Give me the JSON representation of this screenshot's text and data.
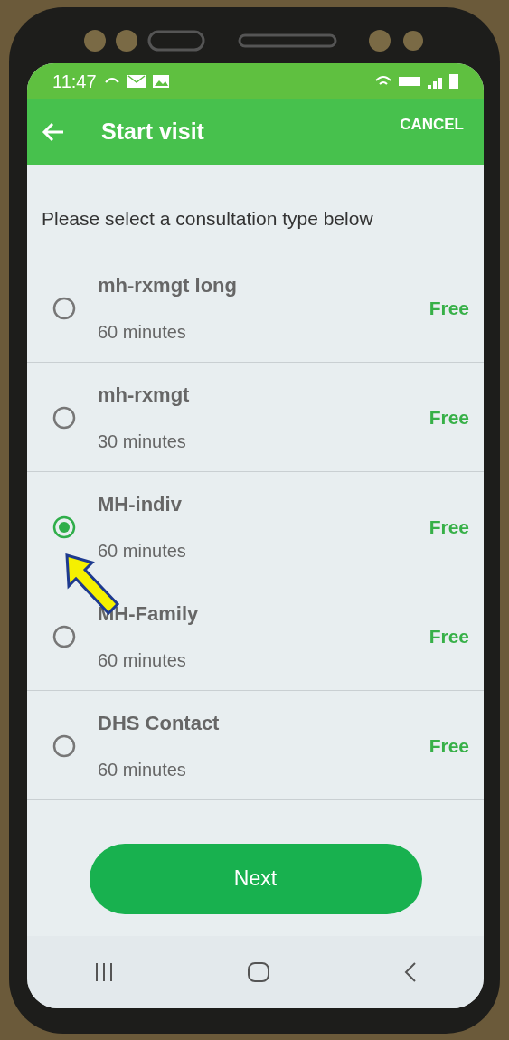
{
  "status_bar": {
    "time": "11:47"
  },
  "app_bar": {
    "title": "Start visit",
    "action": "CANCEL"
  },
  "prompt": "Please select a consultation type below",
  "options": [
    {
      "name": "mh-rxmgt long",
      "duration": "60 minutes",
      "price": "Free",
      "selected": false
    },
    {
      "name": "mh-rxmgt",
      "duration": "30 minutes",
      "price": "Free",
      "selected": false
    },
    {
      "name": "MH-indiv",
      "duration": "60 minutes",
      "price": "Free",
      "selected": true
    },
    {
      "name": "MH-Family",
      "duration": "60 minutes",
      "price": "Free",
      "selected": false
    },
    {
      "name": "DHS Contact",
      "duration": "60 minutes",
      "price": "Free",
      "selected": false
    }
  ],
  "next_button": "Next"
}
